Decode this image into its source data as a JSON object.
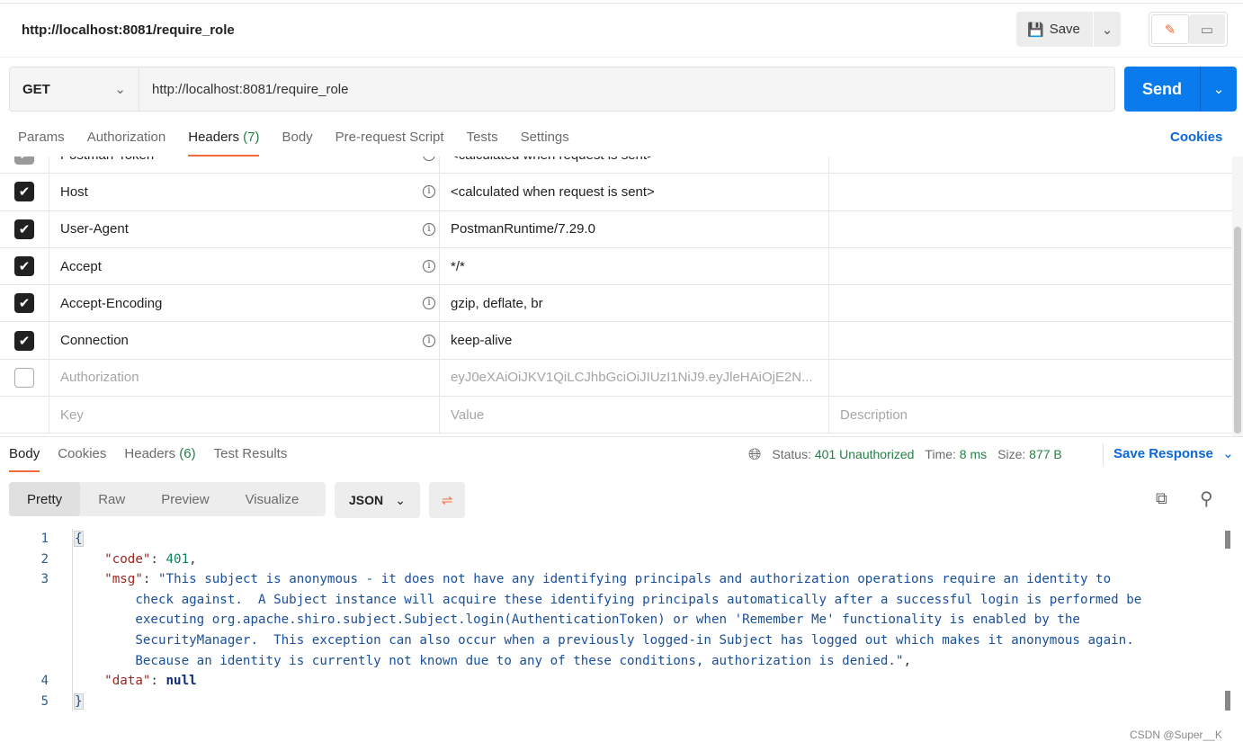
{
  "header": {
    "title": "http://localhost:8081/require_role",
    "save_label": "Save"
  },
  "request": {
    "method": "GET",
    "url": "http://localhost:8081/require_role",
    "send_label": "Send"
  },
  "tabs": [
    {
      "label": "Params"
    },
    {
      "label": "Authorization"
    },
    {
      "label": "Headers",
      "count": "(7)"
    },
    {
      "label": "Body"
    },
    {
      "label": "Pre-request Script"
    },
    {
      "label": "Tests"
    },
    {
      "label": "Settings"
    }
  ],
  "cookies_label": "Cookies",
  "headers": [
    {
      "key": "Postman-Token",
      "value": "<calculated when request is sent>",
      "checked": true
    },
    {
      "key": "Host",
      "value": "<calculated when request is sent>",
      "checked": true
    },
    {
      "key": "User-Agent",
      "value": "PostmanRuntime/7.29.0",
      "checked": true
    },
    {
      "key": "Accept",
      "value": "*/*",
      "checked": true
    },
    {
      "key": "Accept-Encoding",
      "value": "gzip, deflate, br",
      "checked": true
    },
    {
      "key": "Connection",
      "value": "keep-alive",
      "checked": true
    },
    {
      "key": "Authorization",
      "value": "eyJ0eXAiOiJKV1QiLCJhbGciOiJIUzI1NiJ9.eyJleHAiOjE2N...",
      "checked": false
    }
  ],
  "placeholders": {
    "key": "Key",
    "value": "Value",
    "description": "Description"
  },
  "response": {
    "tabs": [
      {
        "label": "Body"
      },
      {
        "label": "Cookies"
      },
      {
        "label": "Headers",
        "count": "(6)"
      },
      {
        "label": "Test Results"
      }
    ],
    "status_label": "Status:",
    "status": "401 Unauthorized",
    "time_label": "Time:",
    "time": "8 ms",
    "size_label": "Size:",
    "size": "877 B",
    "save_response": "Save Response",
    "views": [
      "Pretty",
      "Raw",
      "Preview",
      "Visualize"
    ],
    "format": "JSON",
    "lines": [
      "{",
      "\"code\"",
      "401",
      "\"msg\"",
      "\"This subject is anonymous - it does not have any identifying principals and authorization operations require an identity to",
      "check against.  A Subject instance will acquire these identifying principals automatically after a successful login is performed be",
      "executing org.apache.shiro.subject.Subject.login(AuthenticationToken) or when 'Remember Me' functionality is enabled by the",
      "SecurityManager.  This exception can also occur when a previously logged-in Subject has logged out which makes it anonymous again.",
      "Because an identity is currently not known due to any of these conditions, authorization is denied.\"",
      "\"data\"",
      "null",
      "}"
    ],
    "line_numbers": [
      "1",
      "2",
      "3",
      "4",
      "5"
    ]
  },
  "watermark": "CSDN @Super__K",
  "colors": {
    "accent": "#f26b3a",
    "send": "#097bed",
    "link": "#0b68d8",
    "status_ok_text": "#268046"
  }
}
